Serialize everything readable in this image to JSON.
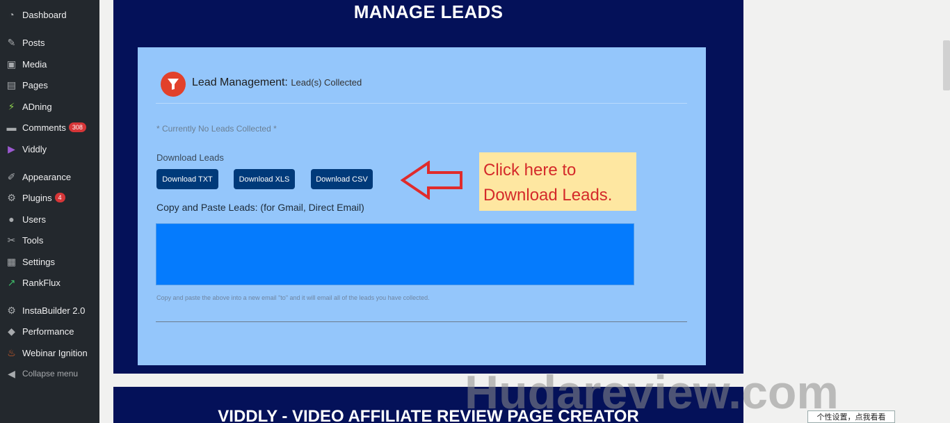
{
  "sidebar": {
    "items": [
      {
        "label": "Dashboard",
        "icon": "dashboard-icon",
        "glyph": "◔"
      },
      {
        "label": "Posts",
        "icon": "pin-icon",
        "glyph": "✎"
      },
      {
        "label": "Media",
        "icon": "media-icon",
        "glyph": "▣"
      },
      {
        "label": "Pages",
        "icon": "pages-icon",
        "glyph": "▤"
      },
      {
        "label": "ADning",
        "icon": "lightning-icon",
        "glyph": "⚡"
      },
      {
        "label": "Comments",
        "icon": "comment-icon",
        "glyph": "▬",
        "badge": "308"
      },
      {
        "label": "Viddly",
        "icon": "viddly-icon",
        "glyph": "▶"
      },
      {
        "label": "Appearance",
        "icon": "brush-icon",
        "glyph": "✐"
      },
      {
        "label": "Plugins",
        "icon": "plug-icon",
        "glyph": "⚙",
        "badge": "4"
      },
      {
        "label": "Users",
        "icon": "user-icon",
        "glyph": "●"
      },
      {
        "label": "Tools",
        "icon": "wrench-icon",
        "glyph": "✂"
      },
      {
        "label": "Settings",
        "icon": "settings-icon",
        "glyph": "▦"
      },
      {
        "label": "RankFlux",
        "icon": "chart-icon",
        "glyph": "↗"
      },
      {
        "label": "InstaBuilder 2.0",
        "icon": "gear-icon",
        "glyph": "⚙"
      },
      {
        "label": "Performance",
        "icon": "cube-icon",
        "glyph": "◆"
      },
      {
        "label": "Webinar Ignition",
        "icon": "flame-icon",
        "glyph": "♨"
      },
      {
        "label": "Collapse menu",
        "icon": "collapse-icon",
        "glyph": "◀"
      }
    ]
  },
  "main": {
    "title": "MANAGE LEADS",
    "card": {
      "title": "Lead Management:",
      "subtitle": "Lead(s) Collected",
      "no_leads": "* Currently No Leads Collected *",
      "download_label": "Download Leads",
      "buttons": [
        "Download TXT",
        "Download XLS",
        "Download CSV"
      ],
      "copy_label": "Copy and Paste Leads: (for Gmail, Direct Email)",
      "leads_value": "",
      "hint": "Copy and paste the above into a new email \"to\" and it will email all of the leads you have collected."
    },
    "annotation": {
      "line1": "Click here to",
      "line2": "Download Leads."
    },
    "second_title": "VIDDLY - VIDEO AFFILIATE REVIEW PAGE CREATOR"
  },
  "watermark": "Hudareview.com",
  "tooltip": "个性设置，点我看看",
  "colors": {
    "sidebar_bg": "#23282d",
    "panel_bg": "#041159",
    "card_bg": "#94c6fb",
    "button_bg": "#003a7a",
    "leads_box": "#057bfd",
    "annotation_bg": "#fee7a1",
    "annotation_text": "#d42a2a"
  }
}
